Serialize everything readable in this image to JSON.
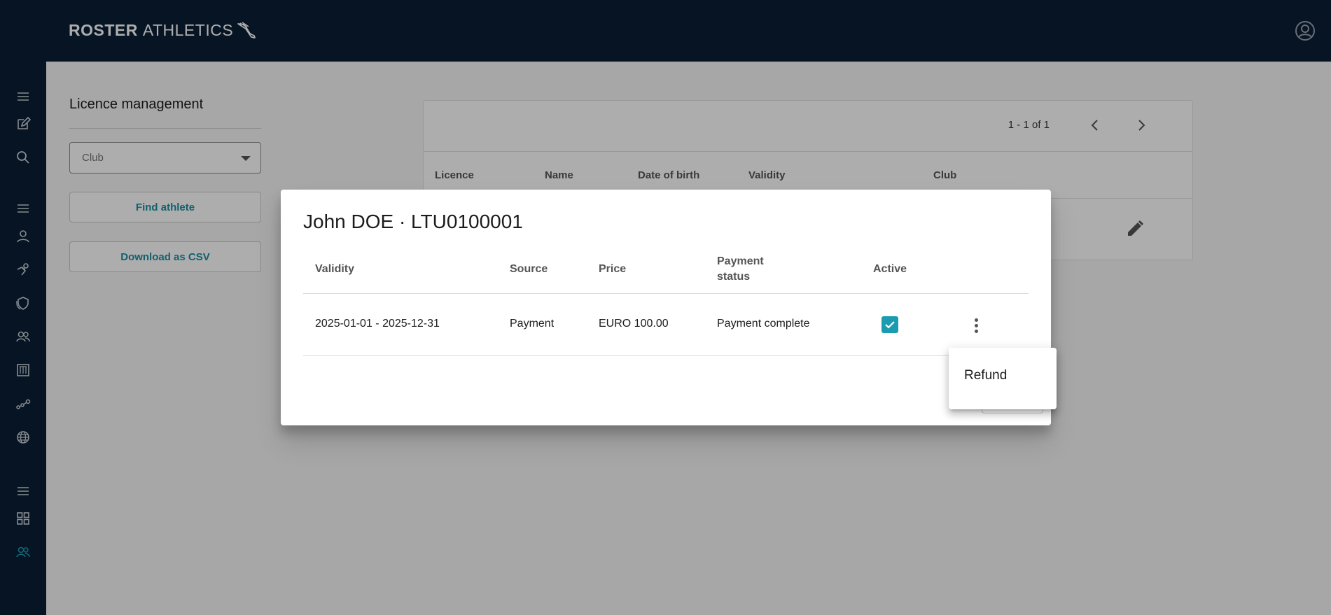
{
  "app": {
    "logo_bold": "ROSTER",
    "logo_light": "ATHLETICS"
  },
  "sidebar": {
    "icons": [
      "menu-icon",
      "edit-icon",
      "search-icon",
      "menu-icon",
      "person-icon",
      "athlete-icon",
      "shield-icon",
      "group-icon",
      "calendar-icon",
      "chart-icon",
      "globe-icon",
      "menu-icon",
      "grid-icon",
      "group-icon"
    ],
    "active_color": "#1a9bb0"
  },
  "page": {
    "title": "Licence management",
    "club_placeholder": "Club",
    "find_athlete": "Find athlete",
    "download_csv": "Download as CSV"
  },
  "results": {
    "pager_text": "1 - 1 of 1",
    "columns": [
      "Licence",
      "Name",
      "Date of birth",
      "Validity",
      "Club"
    ]
  },
  "dialog": {
    "title": "John DOE · LTU0100001",
    "columns": {
      "validity": "Validity",
      "source": "Source",
      "price": "Price",
      "payment_status_line1": "Payment",
      "payment_status_line2": "status",
      "active": "Active"
    },
    "row": {
      "validity": "2025-01-01 - 2025-12-31",
      "source": "Payment",
      "price": "EURO 100.00",
      "payment_status": "Payment complete",
      "active": true
    }
  },
  "menu": {
    "items": [
      "Refund"
    ]
  },
  "colors": {
    "navbar": "#0a1e35",
    "accent": "#1a9bb0"
  }
}
